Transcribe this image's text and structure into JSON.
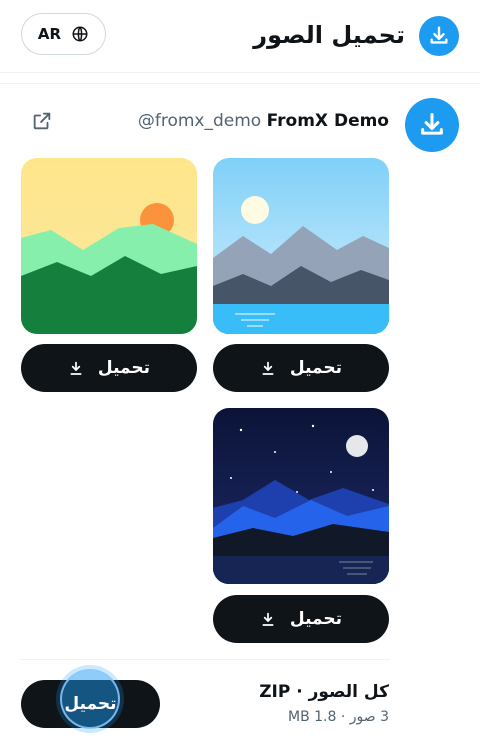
{
  "header": {
    "title": "تحميل الصور",
    "lang_label": "AR"
  },
  "account": {
    "display_name": "FromX Demo",
    "handle": "@fromx_demo"
  },
  "images": [
    {
      "scene": "day-mountains-lake",
      "button_label": "تحميل"
    },
    {
      "scene": "sunset-green-hills",
      "button_label": "تحميل"
    },
    {
      "scene": "night-mountains",
      "button_label": "تحميل"
    }
  ],
  "zip": {
    "title": "كل الصور · ZIP",
    "meta": "3 صور · 1.8 MB",
    "button_label": "تحميل"
  },
  "colors": {
    "accent": "#1d9bf0",
    "button_dark": "#0f1419",
    "muted_text": "#536471"
  },
  "icons": {
    "app": "download-icon",
    "lang": "globe-icon",
    "open": "external-link-icon"
  }
}
